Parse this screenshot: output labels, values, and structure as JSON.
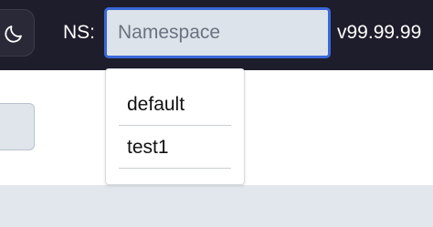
{
  "header": {
    "theme_toggle_icon": "moon-icon",
    "namespace_label": "NS:",
    "namespace_input": {
      "value": "",
      "placeholder": "Namespace"
    },
    "version": "v99.99.99"
  },
  "namespace_dropdown": {
    "options": [
      "default",
      "test1"
    ]
  },
  "colors": {
    "topbar_bg": "#1e1d2b",
    "input_focus_border": "#3a67d8",
    "input_bg": "#dde3ea"
  }
}
